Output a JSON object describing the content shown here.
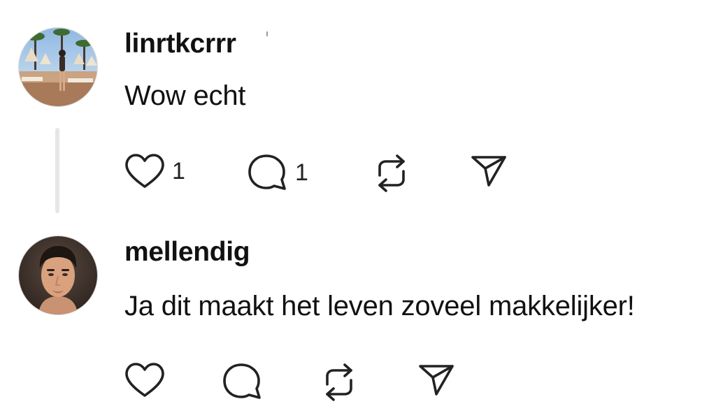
{
  "posts": [
    {
      "username": "linrtkcrrr",
      "text": "Wow echt",
      "avatar": "beach-photo",
      "actions": {
        "like_count": "1",
        "reply_count": "1",
        "repost_count": "",
        "share_count": ""
      }
    },
    {
      "username": "mellendig",
      "text": "Ja dit maakt het leven zoveel makkelijker!",
      "avatar": "portrait-photo",
      "actions": {
        "like_count": "",
        "reply_count": "",
        "repost_count": "",
        "share_count": ""
      }
    }
  ],
  "icons": {
    "like": "heart-icon",
    "reply": "speech-bubble-icon",
    "repost": "repost-arrows-icon",
    "share": "paper-plane-icon"
  },
  "colors": {
    "text": "#111111",
    "icon": "#222222",
    "thread_line": "#e6e6e6",
    "background": "#ffffff"
  }
}
